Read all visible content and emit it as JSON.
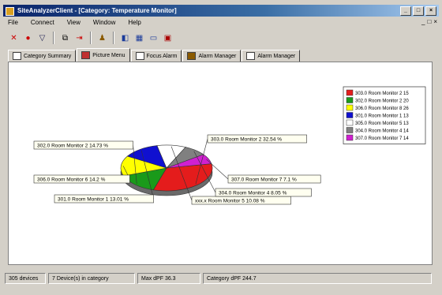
{
  "window": {
    "title": "SiteAnalyzerClient - [Category: Temperature Monitor]",
    "min": "_",
    "max": "□",
    "close": "×"
  },
  "menu": [
    "File",
    "Connect",
    "View",
    "Window",
    "Help"
  ],
  "mdi_controls": [
    "_",
    "□",
    "×"
  ],
  "toolbar": [
    {
      "icon": "pointer-icon",
      "glyph": "✕"
    },
    {
      "icon": "stop-icon",
      "glyph": "●"
    },
    {
      "icon": "filter-icon",
      "glyph": "▽"
    },
    {
      "icon": "copy-icon",
      "glyph": "⧉"
    },
    {
      "icon": "exit-icon",
      "glyph": "⇥"
    },
    {
      "icon": "users-icon",
      "glyph": "♟"
    },
    {
      "icon": "pie-view-icon",
      "glyph": "◧"
    },
    {
      "icon": "grid-view-icon",
      "glyph": "▦"
    },
    {
      "icon": "window-view-icon",
      "glyph": "▭"
    },
    {
      "icon": "alarm-view-icon",
      "glyph": "▣"
    }
  ],
  "tabs": [
    {
      "label": "Category Summary",
      "active": false
    },
    {
      "label": "Picture Menu",
      "active": true
    },
    {
      "label": "Focus Alarm",
      "active": false
    },
    {
      "label": "Alarm Manager",
      "active": false
    },
    {
      "label": "Alarm Manager",
      "active": false
    }
  ],
  "chart_data": {
    "type": "pie",
    "series": [
      {
        "name": "303.0 Room Monitor 2 15",
        "label": "303.0 Room Monitor 2 32.54 %",
        "value": 32.54,
        "color": "#e41c1c"
      },
      {
        "name": "302.0 Room Monitor 2 20",
        "label": "302.0 Room Monitor 2 14.73 %",
        "value": 14.73,
        "color": "#1a9a1a"
      },
      {
        "name": "306.0 Room Monitor 8 26",
        "label": "306.0 Room Monitor 6 14.2 %",
        "value": 14.2,
        "color": "#ffff00"
      },
      {
        "name": "301.0 Room Monitor 1 13",
        "label": "301.0 Room Monitor 1 13.01 %",
        "value": 13.01,
        "color": "#1010d0"
      },
      {
        "name": "305.0 Room Monitor 5 13",
        "label": "xxx.x Room Monitor 5 10.08 %",
        "value": 10.08,
        "color": "#ffffff"
      },
      {
        "name": "304.0 Room Monitor 4 14",
        "label": "304.0 Room Monitor 4 8.05 %",
        "value": 8.05,
        "color": "#808080"
      },
      {
        "name": "307.0 Room Monitor 7 14",
        "label": "307.0 Room Monitor 7 7.1 %",
        "value": 7.1,
        "color": "#d020d0"
      }
    ],
    "legend_position": "top-right"
  },
  "status": [
    "305 devices",
    "7 Device(s) in category",
    "Max dPF 36.3",
    "Category dPF 244.7"
  ]
}
